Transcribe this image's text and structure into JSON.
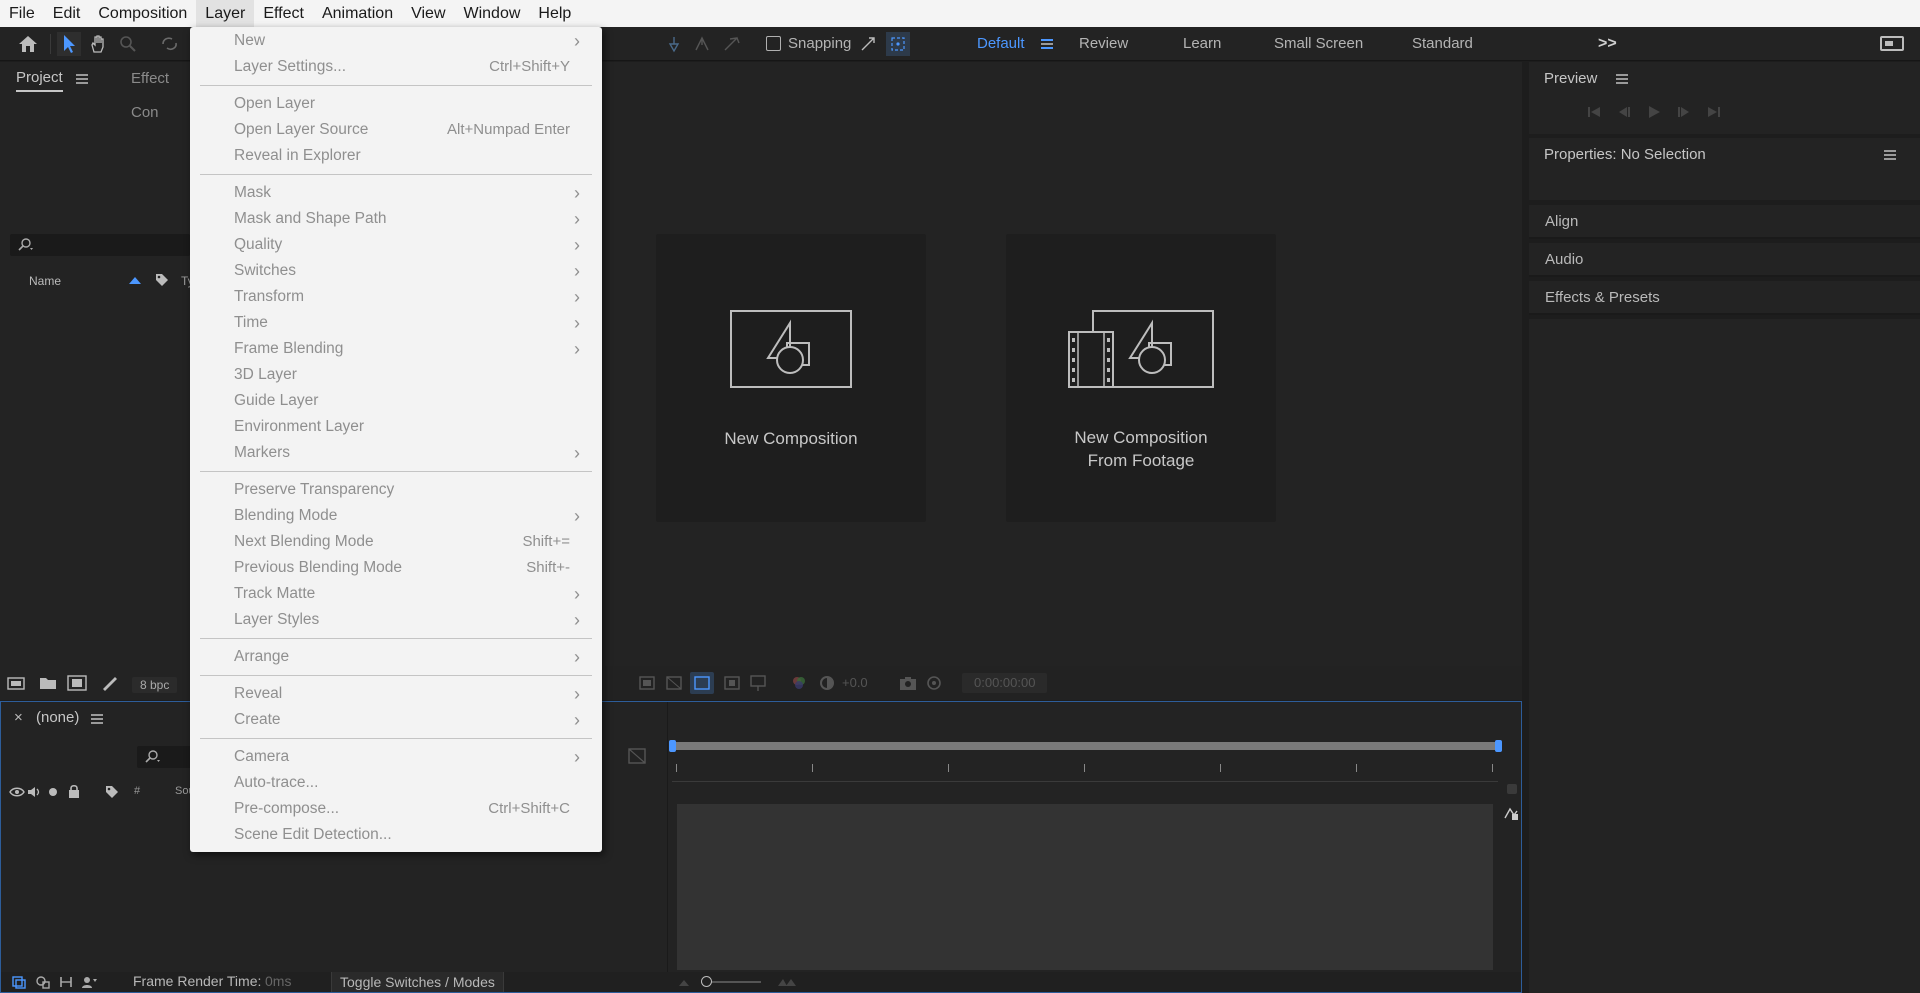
{
  "menubar": {
    "items": [
      "File",
      "Edit",
      "Composition",
      "Layer",
      "Effect",
      "Animation",
      "View",
      "Window",
      "Help"
    ]
  },
  "toolbar": {
    "snapping_label": "Snapping",
    "workspaces": [
      "Default",
      "Review",
      "Learn",
      "Small Screen",
      "Standard"
    ],
    "active_workspace": "Default",
    "more_icon": ">>"
  },
  "project_panel": {
    "tabs": [
      "Project",
      "Effect Controls"
    ],
    "tab_effect_visible": "Effect Con",
    "col_name": "Name",
    "col_type": "Ty",
    "bpc": "8 bpc"
  },
  "composition_panel": {
    "new_comp": "New Composition",
    "new_comp_footage_line1": "New Composition",
    "new_comp_footage_line2": "From Footage",
    "exposure": "+0.0",
    "timecode": "0:00:00:00"
  },
  "timeline": {
    "close": "×",
    "comp_name": "(none)",
    "col_hash": "#",
    "col_source": "Sou",
    "frame_render_label": "Frame Render Time:",
    "frame_render_value": "0ms",
    "toggle_label": "Toggle Switches / Modes"
  },
  "right_panels": {
    "preview": "Preview",
    "properties": "Properties: No Selection",
    "align": "Align",
    "audio": "Audio",
    "effects_presets": "Effects & Presets"
  },
  "layer_menu": {
    "items": [
      {
        "label": "New",
        "shortcut": "",
        "submenu": true
      },
      {
        "label": "Layer Settings...",
        "shortcut": "Ctrl+Shift+Y",
        "submenu": false
      },
      {
        "label": "Open Layer",
        "shortcut": "",
        "submenu": false
      },
      {
        "label": "Open Layer Source",
        "shortcut": "Alt+Numpad Enter",
        "submenu": false
      },
      {
        "label": "Reveal in Explorer",
        "shortcut": "",
        "submenu": false
      },
      {
        "label": "Mask",
        "shortcut": "",
        "submenu": true
      },
      {
        "label": "Mask and Shape Path",
        "shortcut": "",
        "submenu": true
      },
      {
        "label": "Quality",
        "shortcut": "",
        "submenu": true
      },
      {
        "label": "Switches",
        "shortcut": "",
        "submenu": true
      },
      {
        "label": "Transform",
        "shortcut": "",
        "submenu": true
      },
      {
        "label": "Time",
        "shortcut": "",
        "submenu": true
      },
      {
        "label": "Frame Blending",
        "shortcut": "",
        "submenu": true
      },
      {
        "label": "3D Layer",
        "shortcut": "",
        "submenu": false
      },
      {
        "label": "Guide Layer",
        "shortcut": "",
        "submenu": false
      },
      {
        "label": "Environment Layer",
        "shortcut": "",
        "submenu": false
      },
      {
        "label": "Markers",
        "shortcut": "",
        "submenu": true
      },
      {
        "label": "Preserve Transparency",
        "shortcut": "",
        "submenu": false
      },
      {
        "label": "Blending Mode",
        "shortcut": "",
        "submenu": true
      },
      {
        "label": "Next Blending Mode",
        "shortcut": "Shift+=",
        "submenu": false
      },
      {
        "label": "Previous Blending Mode",
        "shortcut": "Shift+-",
        "submenu": false
      },
      {
        "label": "Track Matte",
        "shortcut": "",
        "submenu": true
      },
      {
        "label": "Layer Styles",
        "shortcut": "",
        "submenu": true
      },
      {
        "label": "Arrange",
        "shortcut": "",
        "submenu": true
      },
      {
        "label": "Reveal",
        "shortcut": "",
        "submenu": true
      },
      {
        "label": "Create",
        "shortcut": "",
        "submenu": true
      },
      {
        "label": "Camera",
        "shortcut": "",
        "submenu": true
      },
      {
        "label": "Auto-trace...",
        "shortcut": "",
        "submenu": false
      },
      {
        "label": "Pre-compose...",
        "shortcut": "Ctrl+Shift+C",
        "submenu": false
      },
      {
        "label": "Scene Edit Detection...",
        "shortcut": "",
        "submenu": false
      }
    ]
  },
  "colors": {
    "accent": "#4c97ff",
    "panel_bg": "#232323",
    "menu_bg": "#f3f3f3"
  }
}
